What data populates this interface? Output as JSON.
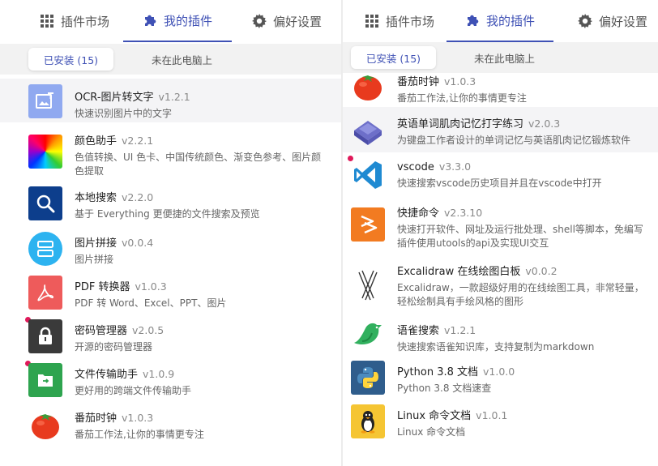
{
  "tabs": {
    "market": "插件市场",
    "mine": "我的插件",
    "prefs": "偏好设置"
  },
  "subtabs": {
    "installed": "已安装 (15)",
    "not_on_pc": "未在此电脑上"
  },
  "colors": {
    "accent": "#3f51b5",
    "badge": "#e0195a"
  },
  "left_items": [
    {
      "name": "OCR-图片转文字",
      "version": "v1.2.1",
      "desc": "快速识别图片中的文字",
      "icon": "ocr-icon"
    },
    {
      "name": "颜色助手",
      "version": "v2.2.1",
      "desc": "色值转换、UI 色卡、中国传统颜色、渐变色参考、图片颜色提取",
      "icon": "color-wheel-icon"
    },
    {
      "name": "本地搜索",
      "version": "v2.2.0",
      "desc": "基于 Everything 更便捷的文件搜索及预览",
      "icon": "magnifier-icon"
    },
    {
      "name": "图片拼接",
      "version": "v0.0.4",
      "desc": "图片拼接",
      "icon": "image-join-icon"
    },
    {
      "name": "PDF 转换器",
      "version": "v1.0.3",
      "desc": "PDF 转 Word、Excel、PPT、图片",
      "icon": "pdf-icon"
    },
    {
      "name": "密码管理器",
      "version": "v2.0.5",
      "desc": "开源的密码管理器",
      "icon": "lock-icon"
    },
    {
      "name": "文件传输助手",
      "version": "v1.0.9",
      "desc": "更好用的跨端文件传输助手",
      "icon": "file-transfer-icon"
    },
    {
      "name": "番茄时钟",
      "version": "v1.0.3",
      "desc": "番茄工作法,让你的事情更专注",
      "icon": "tomato-icon"
    }
  ],
  "right_items": [
    {
      "name": "番茄时钟",
      "version": "v1.0.3",
      "desc": "番茄工作法,让你的事情更专注",
      "icon": "tomato-icon"
    },
    {
      "name": "英语单词肌肉记忆打字练习",
      "version": "v2.0.3",
      "desc": "为键盘工作者设计的单词记忆与英语肌肉记忆锻炼软件",
      "icon": "keycap-icon"
    },
    {
      "name": "vscode",
      "version": "v3.3.0",
      "desc": "快速搜索vscode历史项目并且在vscode中打开",
      "icon": "vscode-icon"
    },
    {
      "name": "快捷命令",
      "version": "v2.3.10",
      "desc": "快速打开软件、网址及运行批处理、shell等脚本，免编写插件使用utools的api及实现UI交互",
      "icon": "quick-command-icon"
    },
    {
      "name": "Excalidraw 在线绘图白板",
      "version": "v0.0.2",
      "desc": "Excalidraw，一款超级好用的在线绘图工具，非常轻量，轻松绘制具有手绘风格的图形",
      "icon": "excalidraw-icon"
    },
    {
      "name": "语雀搜索",
      "version": "v1.2.1",
      "desc": "快速搜索语雀知识库，支持复制为markdown",
      "icon": "yuque-bird-icon"
    },
    {
      "name": "Python 3.8 文档",
      "version": "v1.0.0",
      "desc": "Python 3.8 文档速查",
      "icon": "python-icon"
    },
    {
      "name": "Linux 命令文档",
      "version": "v1.0.1",
      "desc": "Linux 命令文档",
      "icon": "linux-penguin-icon"
    }
  ]
}
